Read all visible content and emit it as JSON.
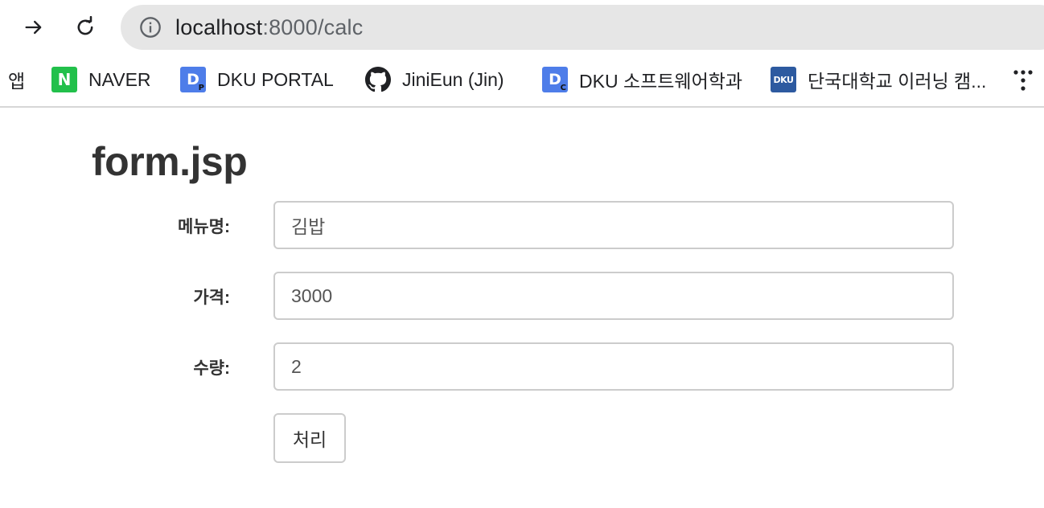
{
  "browser": {
    "url_host": "localhost",
    "url_path": ":8000/calc",
    "icons": {
      "forward": "arrow-right-icon",
      "reload": "reload-icon",
      "site_info": "info-icon",
      "more": "more-dots-icon"
    }
  },
  "bookmarks": {
    "items": [
      {
        "label": "앱",
        "icon": "apps-icon"
      },
      {
        "label": "NAVER",
        "icon": "naver-icon",
        "fav_text": "N",
        "color": "#22c04b"
      },
      {
        "label": "DKU PORTAL",
        "icon": "dku-portal-icon",
        "fav_text": "D",
        "fav_sub": "P",
        "color": "#4e7de9"
      },
      {
        "label": "JiniEun (Jin)",
        "icon": "github-icon"
      },
      {
        "label": "DKU 소프트웨어학과",
        "icon": "dku-software-icon",
        "fav_text": "D",
        "fav_sub": "C",
        "color": "#4e7de9"
      },
      {
        "label": "단국대학교 이러닝 캠...",
        "icon": "dku-elearning-icon",
        "fav_text": "DKU",
        "color": "#2d5aa0"
      }
    ]
  },
  "page": {
    "title": "form.jsp",
    "fields": [
      {
        "label": "메뉴명:",
        "value": "김밥"
      },
      {
        "label": "가격:",
        "value": "3000"
      },
      {
        "label": "수량:",
        "value": "2"
      }
    ],
    "submit_label": "처리"
  }
}
